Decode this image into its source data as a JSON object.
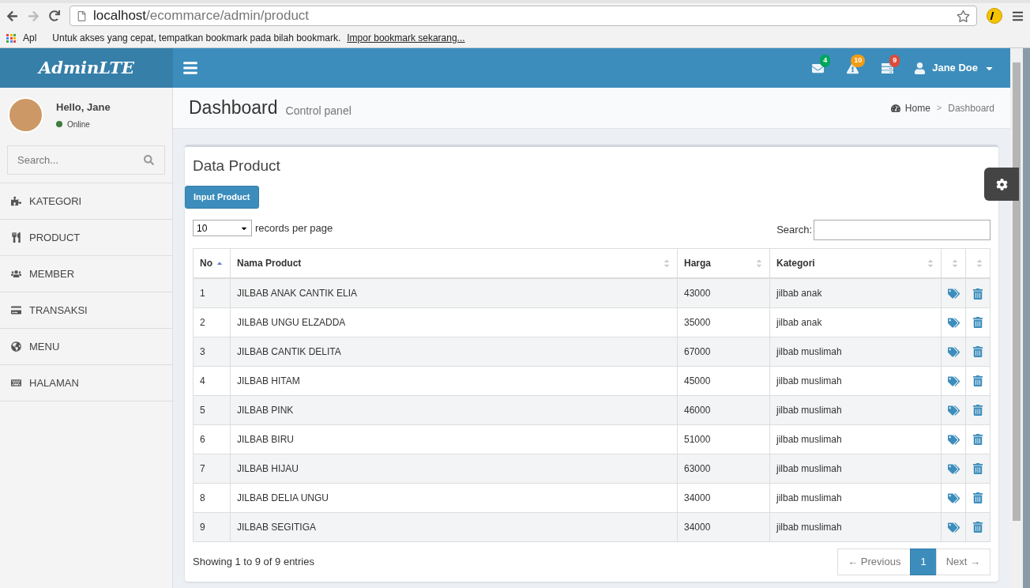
{
  "browser": {
    "url_host": "localhost",
    "url_path": "/ecommarce/admin/product",
    "apps_label": "Apl",
    "bookmark_hint": "Untuk akses yang cepat, tempatkan bookmark pada bilah bookmark.",
    "bookmark_link": "Impor bookmark sekarang..."
  },
  "header": {
    "logo": "AdminLTE",
    "notifications": [
      {
        "kind": "mail",
        "count": "4",
        "color": "#00a65a"
      },
      {
        "kind": "warning",
        "count": "10",
        "color": "#f39c12"
      },
      {
        "kind": "tasks",
        "count": "9",
        "color": "#dd4b39"
      }
    ],
    "user": "Jane Doe"
  },
  "sidebar": {
    "greeting": "Hello, Jane",
    "status": "Online",
    "search": {
      "placeholder": "Search..."
    },
    "items": [
      {
        "label": "KATEGORI"
      },
      {
        "label": "PRODUCT"
      },
      {
        "label": "MEMBER"
      },
      {
        "label": "TRANSAKSI"
      },
      {
        "label": "MENU"
      },
      {
        "label": "HALAMAN"
      }
    ]
  },
  "page": {
    "title": "Dashboard",
    "subtitle": "Control panel",
    "breadcrumb_separator": ">",
    "breadcrumb": [
      {
        "label": "Home"
      },
      {
        "label": "Dashboard"
      }
    ]
  },
  "box": {
    "title": "Data Product",
    "button": "Input Product",
    "page_length": "10",
    "page_length_label": "records per page",
    "search_label": "Search:",
    "table": {
      "columns": [
        {
          "label": "No",
          "sorted": true
        },
        {
          "label": "Nama Product",
          "sorted": false
        },
        {
          "label": "Harga",
          "sorted": false
        },
        {
          "label": "Kategori",
          "sorted": false
        },
        {
          "sorted": false
        },
        {
          "sorted": false
        }
      ],
      "rows": [
        [
          "1",
          "JILBAB ANAK CANTIK ELIA",
          "43000",
          "jilbab anak"
        ],
        [
          "2",
          "JILBAB UNGU ELZADDA",
          "35000",
          "jilbab anak"
        ],
        [
          "3",
          "JILBAB CANTIK DELITA",
          "67000",
          "jilbab muslimah"
        ],
        [
          "4",
          "JILBAB HITAM",
          "45000",
          "jilbab muslimah"
        ],
        [
          "5",
          "JILBAB PINK",
          "46000",
          "jilbab muslimah"
        ],
        [
          "6",
          "JILBAB BIRU",
          "51000",
          "jilbab muslimah"
        ],
        [
          "7",
          "JILBAB HIJAU",
          "63000",
          "jilbab muslimah"
        ],
        [
          "8",
          "JILBAB DELIA UNGU",
          "34000",
          "jilbab muslimah"
        ],
        [
          "9",
          "JILBAB SEGITIGA",
          "34000",
          "jilbab muslimah"
        ]
      ]
    },
    "info": "Showing 1 to 9 of 9 entries",
    "pagination": [
      {
        "label": "← Previous",
        "selected": false,
        "disabled": true
      },
      {
        "label": "1",
        "selected": true,
        "disabled": false
      },
      {
        "label": "Next →",
        "selected": false,
        "disabled": true
      }
    ]
  }
}
